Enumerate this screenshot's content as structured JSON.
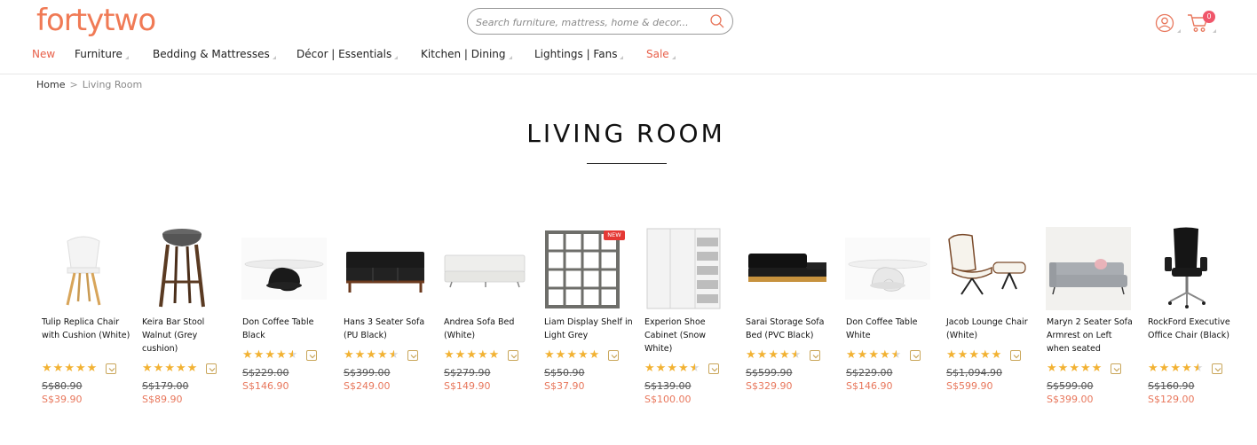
{
  "brand": {
    "logo": "fortytwo",
    "accent": "#f07a55"
  },
  "search": {
    "placeholder": "Search furniture, mattress, home & decor..."
  },
  "header": {
    "cart_count": "0"
  },
  "nav": [
    {
      "label": "New",
      "accent": true,
      "caret": false
    },
    {
      "label": "Furniture",
      "accent": false,
      "caret": true
    },
    {
      "label": "Bedding & Mattresses",
      "accent": false,
      "caret": true
    },
    {
      "label": "Décor | Essentials",
      "accent": false,
      "caret": true
    },
    {
      "label": "Kitchen | Dining",
      "accent": false,
      "caret": true
    },
    {
      "label": "Lightings | Fans",
      "accent": false,
      "caret": true
    },
    {
      "label": "Sale",
      "accent": true,
      "caret": true
    }
  ],
  "breadcrumb": {
    "home": "Home",
    "separator": ">",
    "current": "Living Room"
  },
  "page": {
    "title": "LIVING ROOM"
  },
  "products": [
    {
      "name": "Tulip Replica Chair with Cushion (White)",
      "rating": 5,
      "old_price": "S$80.90",
      "price": "S$39.90",
      "badge": ""
    },
    {
      "name": "Keira Bar Stool Walnut (Grey cushion)",
      "rating": 5,
      "old_price": "S$179.00",
      "price": "S$89.90",
      "badge": ""
    },
    {
      "name": "Don Coffee Table Black",
      "rating": 4.5,
      "old_price": "S$229.00",
      "price": "S$146.90",
      "badge": ""
    },
    {
      "name": "Hans 3 Seater Sofa (PU Black)",
      "rating": 4.5,
      "old_price": "S$399.00",
      "price": "S$249.00",
      "badge": ""
    },
    {
      "name": "Andrea Sofa Bed (White)",
      "rating": 5,
      "old_price": "S$279.90",
      "price": "S$149.90",
      "badge": ""
    },
    {
      "name": "Liam Display Shelf in Light Grey",
      "rating": 5,
      "old_price": "S$50.90",
      "price": "S$37.90",
      "badge": "NEW"
    },
    {
      "name": "Experion Shoe Cabinet (Snow White)",
      "rating": 4.5,
      "old_price": "S$139.00",
      "price": "S$100.00",
      "badge": ""
    },
    {
      "name": "Sarai Storage Sofa Bed (PVC Black)",
      "rating": 4.5,
      "old_price": "S$599.90",
      "price": "S$329.90",
      "badge": ""
    },
    {
      "name": "Don Coffee Table White",
      "rating": 4.5,
      "old_price": "S$229.00",
      "price": "S$146.90",
      "badge": ""
    },
    {
      "name": "Jacob Lounge Chair (White)",
      "rating": 5,
      "old_price": "S$1,094.90",
      "price": "S$599.90",
      "badge": ""
    },
    {
      "name": "Maryn 2 Seater Sofa Armrest on Left when seated",
      "rating": 5,
      "old_price": "S$599.00",
      "price": "S$399.00",
      "badge": ""
    },
    {
      "name": "RockFord Executive Office Chair (Black)",
      "rating": 4.5,
      "old_price": "S$160.90",
      "price": "S$129.00",
      "badge": ""
    }
  ]
}
